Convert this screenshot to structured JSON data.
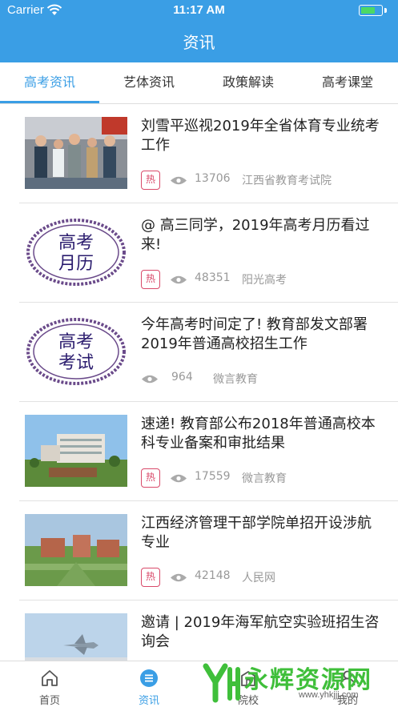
{
  "status_bar": {
    "carrier": "Carrier",
    "time": "11:17 AM",
    "battery_level": 0.7
  },
  "header": {
    "title": "资讯"
  },
  "tabs": [
    {
      "label": "高考资讯",
      "active": true
    },
    {
      "label": "艺体资讯",
      "active": false
    },
    {
      "label": "政策解读",
      "active": false
    },
    {
      "label": "高考课堂",
      "active": false
    }
  ],
  "articles": [
    {
      "title": "刘雪平巡视2019年全省体育专业统考工作",
      "hot_label": "热",
      "views": "13706",
      "source": "江西省教育考试院",
      "thumbnail": "event-photo"
    },
    {
      "title": "@ 高三同学，2019年高考月历看过来!",
      "hot_label": "热",
      "views": "48351",
      "source": "阳光高考",
      "thumbnail": "stamp-badge",
      "badge_text": [
        "高考",
        "月历"
      ]
    },
    {
      "title": "今年高考时间定了! 教育部发文部署2019年普通高校招生工作",
      "hot_label": "",
      "views": "964",
      "source": "微言教育",
      "thumbnail": "stamp-badge",
      "badge_text": [
        "高考",
        "考试"
      ]
    },
    {
      "title": "速递! 教育部公布2018年普通高校本科专业备案和审批结果",
      "hot_label": "热",
      "views": "17559",
      "source": "微言教育",
      "thumbnail": "campus-photo"
    },
    {
      "title": "江西经济管理干部学院单招开设涉航专业",
      "hot_label": "热",
      "views": "42148",
      "source": "人民网",
      "thumbnail": "aerial-photo"
    },
    {
      "title": "邀请 | 2019年海军航空实验班招生咨询会",
      "hot_label": "",
      "views": "",
      "source": "",
      "thumbnail": "jet-photo"
    }
  ],
  "bottom_nav": [
    {
      "label": "首页",
      "icon": "home-icon",
      "active": false
    },
    {
      "label": "资讯",
      "icon": "news-icon",
      "active": true
    },
    {
      "label": "院校",
      "icon": "school-icon",
      "active": false
    },
    {
      "label": "我的",
      "icon": "profile-icon",
      "active": false
    }
  ],
  "watermark": {
    "text": "永辉资源网",
    "url": "www.yhkjjj.com"
  },
  "colors": {
    "primary": "#3a9ee5",
    "hot": "#d94a6a",
    "watermark": "#3fbf3a"
  }
}
